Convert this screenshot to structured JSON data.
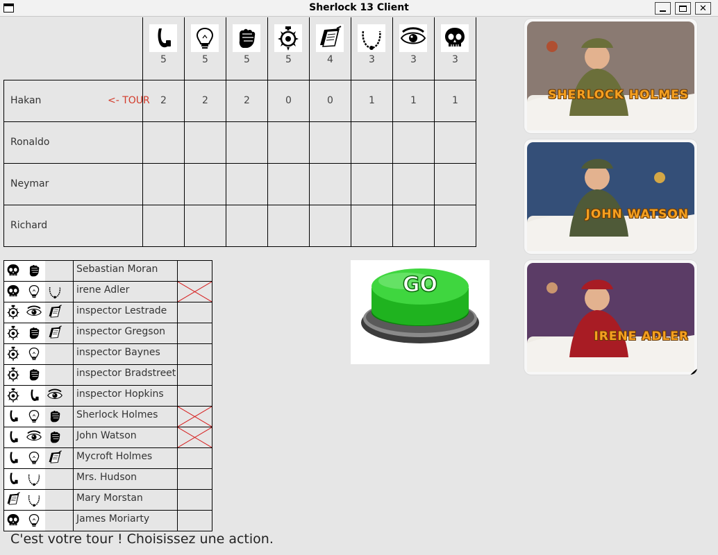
{
  "window": {
    "title": "Sherlock 13 Client",
    "min": "",
    "max": "",
    "close": "✕"
  },
  "symbols": [
    {
      "icon": "pipe-icon",
      "count": "5"
    },
    {
      "icon": "lightbulb-icon",
      "count": "5"
    },
    {
      "icon": "fist-icon",
      "count": "5"
    },
    {
      "icon": "badge-icon",
      "count": "5"
    },
    {
      "icon": "notebook-icon",
      "count": "4"
    },
    {
      "icon": "necklace-icon",
      "count": "3"
    },
    {
      "icon": "eye-icon",
      "count": "3"
    },
    {
      "icon": "skull-icon",
      "count": "3"
    }
  ],
  "players": [
    {
      "name": "Hakan",
      "turn_marker": "<- TOUR",
      "values": [
        "2",
        "2",
        "2",
        "0",
        "0",
        "1",
        "1",
        "1"
      ]
    },
    {
      "name": "Ronaldo",
      "turn_marker": "",
      "values": [
        "",
        "",
        "",
        "",
        "",
        "",
        "",
        ""
      ]
    },
    {
      "name": "Neymar",
      "turn_marker": "",
      "values": [
        "",
        "",
        "",
        "",
        "",
        "",
        "",
        ""
      ]
    },
    {
      "name": "Richard",
      "turn_marker": "",
      "values": [
        "",
        "",
        "",
        "",
        "",
        "",
        "",
        ""
      ]
    }
  ],
  "suspects": [
    {
      "name": "Sebastian Moran",
      "icons": [
        "skull-icon",
        "fist-icon"
      ],
      "crossed": false
    },
    {
      "name": "irene Adler",
      "icons": [
        "skull-icon",
        "lightbulb-icon",
        "necklace-icon"
      ],
      "crossed": true
    },
    {
      "name": "inspector Lestrade",
      "icons": [
        "badge-icon",
        "eye-icon",
        "notebook-icon"
      ],
      "crossed": false
    },
    {
      "name": "inspector Gregson",
      "icons": [
        "badge-icon",
        "fist-icon",
        "notebook-icon"
      ],
      "crossed": false
    },
    {
      "name": "inspector Baynes",
      "icons": [
        "badge-icon",
        "lightbulb-icon"
      ],
      "crossed": false
    },
    {
      "name": "inspector Bradstreet",
      "icons": [
        "badge-icon",
        "fist-icon"
      ],
      "crossed": false
    },
    {
      "name": "inspector Hopkins",
      "icons": [
        "badge-icon",
        "pipe-icon",
        "eye-icon"
      ],
      "crossed": false
    },
    {
      "name": "Sherlock Holmes",
      "icons": [
        "pipe-icon",
        "lightbulb-icon",
        "fist-icon"
      ],
      "crossed": true
    },
    {
      "name": "John Watson",
      "icons": [
        "pipe-icon",
        "eye-icon",
        "fist-icon"
      ],
      "crossed": true
    },
    {
      "name": "Mycroft Holmes",
      "icons": [
        "pipe-icon",
        "lightbulb-icon",
        "notebook-icon"
      ],
      "crossed": false
    },
    {
      "name": "Mrs. Hudson",
      "icons": [
        "pipe-icon",
        "necklace-icon"
      ],
      "crossed": false
    },
    {
      "name": "Mary Morstan",
      "icons": [
        "notebook-icon",
        "necklace-icon"
      ],
      "crossed": false
    },
    {
      "name": "James Moriarty",
      "icons": [
        "skull-icon",
        "lightbulb-icon"
      ],
      "crossed": false
    }
  ],
  "go_button": {
    "label": "GO"
  },
  "cards": [
    {
      "name": "SHERLOCK HOLMES",
      "icons": [
        "pipe-icon",
        "lightbulb-icon",
        "fist-icon"
      ],
      "sky": "#8a7a72",
      "coat": "#6b6f3a",
      "accent": "#b24a2a"
    },
    {
      "name": "JOHN WATSON",
      "icons": [
        "pipe-icon",
        "eye-icon",
        "fist-icon"
      ],
      "sky": "#344f78",
      "coat": "#4f5a38",
      "accent": "#e6b040"
    },
    {
      "name": "IRENE ADLER",
      "icons": [
        "skull-icon",
        "lightbulb-icon",
        "necklace-icon"
      ],
      "sky": "#5b3c66",
      "coat": "#a81c24",
      "accent": "#d6a070"
    }
  ],
  "status": "C'est votre tour ! Choisissez une action."
}
